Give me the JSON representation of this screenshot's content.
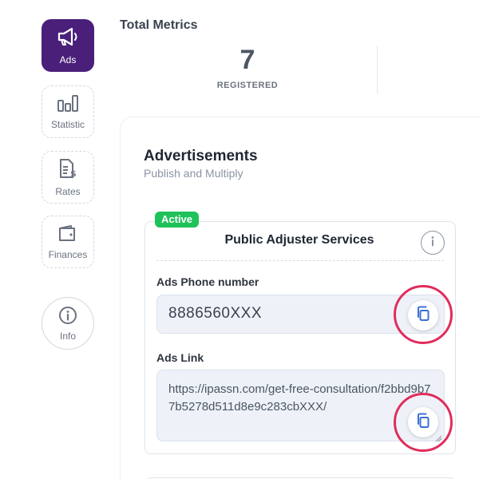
{
  "sidebar": {
    "items": [
      {
        "label": "Ads",
        "icon": "megaphone-icon",
        "active": true
      },
      {
        "label": "Statistic",
        "icon": "bar-chart-icon",
        "active": false
      },
      {
        "label": "Rates",
        "icon": "rates-document-icon",
        "active": false
      },
      {
        "label": "Finances",
        "icon": "wallet-icon",
        "active": false
      }
    ],
    "info": {
      "label": "Info",
      "icon": "info-icon"
    }
  },
  "metrics": {
    "title": "Total Metrics",
    "registered": {
      "value": "7",
      "label": "REGISTERED"
    }
  },
  "advertisements": {
    "title": "Advertisements",
    "subtitle": "Publish and Multiply",
    "ad": {
      "status": "Active",
      "title": "Public Adjuster Services",
      "phone_label": "Ads Phone number",
      "phone_value": "8886560XXX",
      "link_label": "Ads Link",
      "link_value": "https://ipassn.com/get-free-consultation/f2bbd9b77b5278d511d8e9c283cbXXX/"
    }
  },
  "colors": {
    "accent": "#4a1f7a",
    "active_badge": "#1fc25a",
    "highlight_ring": "#e02c5c",
    "copy_icon": "#3b6fd4"
  }
}
